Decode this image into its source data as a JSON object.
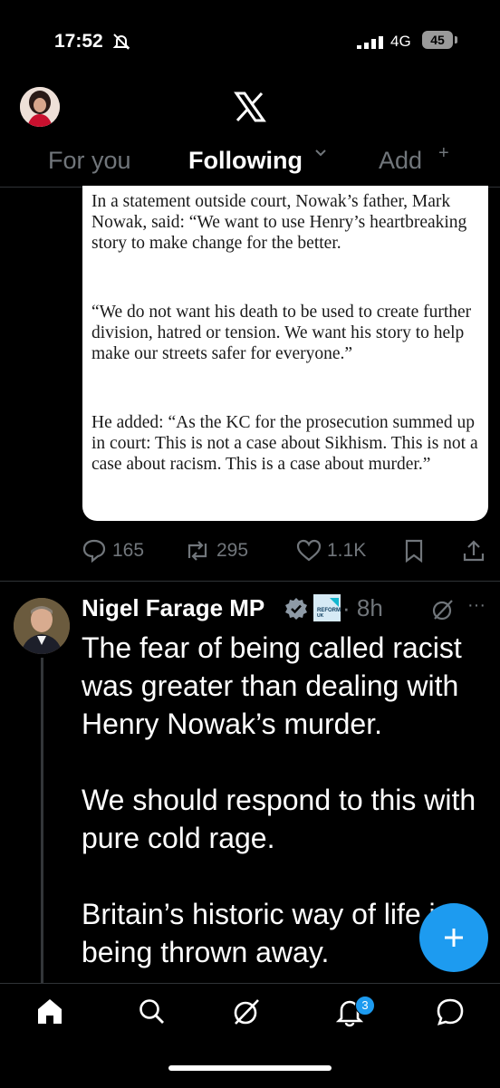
{
  "status_bar": {
    "time": "17:52",
    "network": "4G",
    "battery": "45"
  },
  "header": {
    "tabs": [
      {
        "label": "For you"
      },
      {
        "label": "Following"
      },
      {
        "label": "Add"
      }
    ]
  },
  "quoted_article": {
    "paragraphs": [
      "In a statement outside court, Nowak’s father, Mark Nowak, said: “We want to use Henry’s heartbreaking story to make change for the better.",
      "“We do not want his death to be used to create further division, hatred or tension. We want his story to help make our streets safer for everyone.”",
      "He added: “As the KC for the prosecution summed up in court: This is not a case about Sikhism. This is not a case about racism. This is a case about murder.”"
    ]
  },
  "post_actions": {
    "replies": "165",
    "reposts": "295",
    "likes": "1.1K"
  },
  "post": {
    "author": "Nigel Farage MP",
    "time": "· 8h",
    "affiliation_badge_text": "REFORM UK",
    "more": "···",
    "body": [
      "The fear of being called racist was greater than dealing with Henry Nowak’s murder.",
      "We should respond to this with pure cold rage.",
      "Britain’s historic way of life is being thrown away."
    ]
  },
  "bottom_nav": {
    "notifications_count": "3"
  },
  "colors": {
    "accent": "#1d9bf0",
    "muted": "#71767b",
    "background": "#000000",
    "divider": "#2f3336"
  },
  "icons": [
    "bell-slash-icon",
    "signal-icon",
    "x-logo-icon",
    "chevron-down-icon",
    "plus-icon",
    "reply-icon",
    "repost-icon",
    "like-icon",
    "bookmark-icon",
    "share-icon",
    "verified-icon",
    "grok-icon",
    "more-icon",
    "compose-icon",
    "home-icon",
    "search-icon",
    "notifications-icon",
    "messages-icon"
  ]
}
